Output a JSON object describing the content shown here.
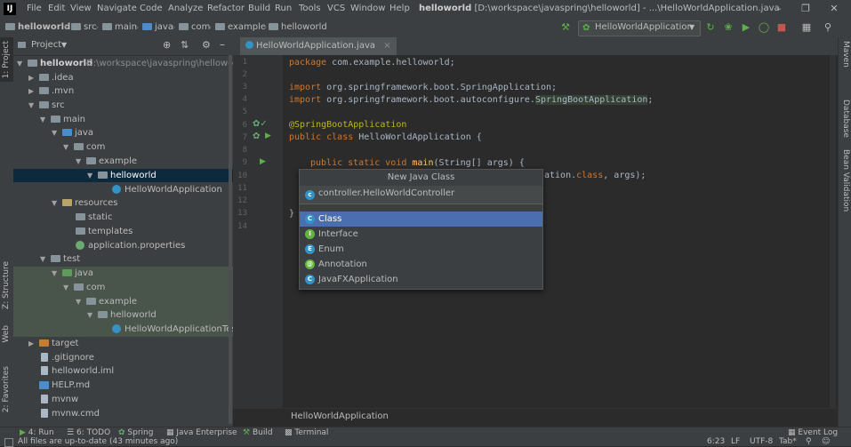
{
  "menu": [
    "File",
    "Edit",
    "View",
    "Navigate",
    "Code",
    "Analyze",
    "Refactor",
    "Build",
    "Run",
    "Tools",
    "VCS",
    "Window",
    "Help"
  ],
  "window_title": {
    "project": "helloworld",
    "path": "[D:\\workspace\\javaspring\\helloworld] - ...\\HelloWorldApplication.java"
  },
  "breadcrumb": [
    "helloworld",
    "src",
    "main",
    "java",
    "com",
    "example",
    "helloworld"
  ],
  "run_config": "HelloWorldApplication",
  "left_stripe": {
    "project": "1: Project",
    "structure": "Z: Structure",
    "web": "Web",
    "favorites": "2: Favorites"
  },
  "right_stripe": {
    "maven": "Maven",
    "database": "Database",
    "bean_validation": "Bean Validation"
  },
  "project_panel": {
    "title": "Project"
  },
  "tree": {
    "root": {
      "label": "helloworld",
      "path": "D:\\workspace\\javaspring\\helloworld"
    },
    "idea": ".idea",
    "mvn": ".mvn",
    "src": "src",
    "main": "main",
    "java": "java",
    "com": "com",
    "example": "example",
    "helloworld": "helloworld",
    "app_class": "HelloWorldApplication",
    "resources": "resources",
    "static": "static",
    "templates": "templates",
    "app_props": "application.properties",
    "test": "test",
    "test_java": "java",
    "test_com": "com",
    "test_example": "example",
    "test_helloworld": "helloworld",
    "test_class": "HelloWorldApplicationTes",
    "target": "target",
    "gitignore": ".gitignore",
    "iml": "helloworld.iml",
    "help": "HELP.md",
    "mvnw": "mvnw",
    "mvnw_cmd": "mvnw.cmd"
  },
  "editor_tab": "HelloWorldApplication.java",
  "line_numbers": [
    "1",
    "2",
    "3",
    "4",
    "5",
    "6",
    "7",
    "8",
    "9",
    "10",
    "11",
    "12",
    "13",
    "14"
  ],
  "code": {
    "l1_kw": "package ",
    "l1_rest": "com.example.helloworld;",
    "l3_kw": "import ",
    "l3_rest": "org.springframework.boot.SpringApplication;",
    "l4_kw": "import ",
    "l4_rest": "org.springframework.boot.autoconfigure.",
    "l4_hl": "SpringBootApplication",
    "l4_end": ";",
    "l6": "@SpringBootApplication",
    "l7_kw": "public class ",
    "l7_rest": "HelloWorldApplication {",
    "l9_kw": "public static void ",
    "l9_fn": "main",
    "l9_rest": "(String[] args) {",
    "l10_rest": "ation.",
    "l10_kw": "class",
    "l10_end": ", args);",
    "l12": "}"
  },
  "editor_breadcrumb": "HelloWorldApplication",
  "popup": {
    "title": "New Java Class",
    "input": "controller.HelloWorldController",
    "items": [
      {
        "label": "Class",
        "icon": "C"
      },
      {
        "label": "Interface",
        "icon": "I"
      },
      {
        "label": "Enum",
        "icon": "E"
      },
      {
        "label": "Annotation",
        "icon": "@"
      },
      {
        "label": "JavaFXApplication",
        "icon": "C"
      }
    ]
  },
  "bottom_tools": [
    "4: Run",
    "6: TODO",
    "Spring",
    "Java Enterprise",
    "Build",
    "Terminal"
  ],
  "event_log": "Event Log",
  "status": {
    "message": "All files are up-to-date (43 minutes ago)",
    "position": "6:23",
    "line_sep": "LF",
    "encoding": "UTF-8",
    "indent": "Tab*"
  },
  "colors": {
    "selection": "#4b6eaf",
    "tree_selection": "#0d293e",
    "test_bg": "#49544a"
  }
}
